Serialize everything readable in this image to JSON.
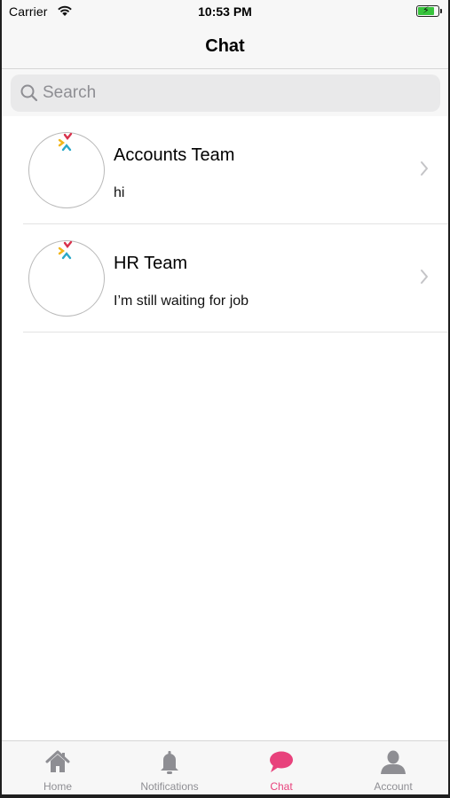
{
  "status_bar": {
    "carrier": "Carrier",
    "time": "10:53 PM",
    "battery_icon": "battery-charging-icon"
  },
  "nav": {
    "title": "Chat"
  },
  "search": {
    "placeholder": "Search"
  },
  "conversations": [
    {
      "name": "Accounts Team",
      "last_message": "hi"
    },
    {
      "name": "HR Team",
      "last_message": "I’m still waiting for job"
    }
  ],
  "tabs": [
    {
      "label": "Home",
      "icon": "home-icon",
      "active": false
    },
    {
      "label": "Notifications",
      "icon": "bell-icon",
      "active": false
    },
    {
      "label": "Chat",
      "icon": "chat-bubble-icon",
      "active": true
    },
    {
      "label": "Account",
      "icon": "person-icon",
      "active": false
    }
  ],
  "colors": {
    "accent": "#e8427c",
    "inactive_tab": "#8e8e93",
    "battery": "#38c43d"
  }
}
